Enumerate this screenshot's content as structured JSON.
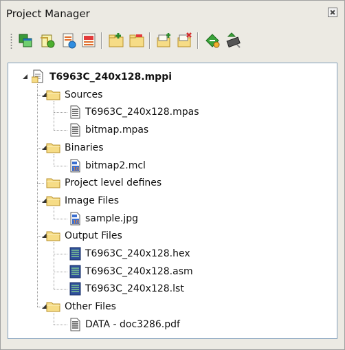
{
  "panel": {
    "title": "Project Manager"
  },
  "toolbar": {
    "buttons": [
      "tile-windows-icon",
      "add-group-icon",
      "add-file-icon",
      "remove-file-icon",
      "new-folder-icon",
      "remove-folder-icon",
      "open-project-icon",
      "close-project-icon",
      "build-icon",
      "program-chip-icon"
    ]
  },
  "tree": {
    "project": "T6963C_240x128.mppi",
    "folders": [
      {
        "label": "Sources",
        "files": [
          {
            "name": "T6963C_240x128.mpas",
            "type": "text"
          },
          {
            "name": "bitmap.mpas",
            "type": "text"
          }
        ]
      },
      {
        "label": "Binaries",
        "files": [
          {
            "name": "bitmap2.mcl",
            "type": "binary"
          }
        ]
      },
      {
        "label": "Project level defines",
        "files": []
      },
      {
        "label": "Image Files",
        "files": [
          {
            "name": "sample.jpg",
            "type": "binary"
          }
        ]
      },
      {
        "label": "Output Files",
        "files": [
          {
            "name": "T6963C_240x128.hex",
            "type": "output"
          },
          {
            "name": "T6963C_240x128.asm",
            "type": "output"
          },
          {
            "name": "T6963C_240x128.lst",
            "type": "output"
          }
        ]
      },
      {
        "label": "Other Files",
        "files": [
          {
            "name": "DATA - doc3286.pdf",
            "type": "text"
          }
        ]
      }
    ]
  },
  "colors": {
    "panel_bg": "#eceae3",
    "folder_fill": "#f6dc86",
    "folder_stroke": "#b8902a",
    "tree_border": "#7f9db9"
  }
}
